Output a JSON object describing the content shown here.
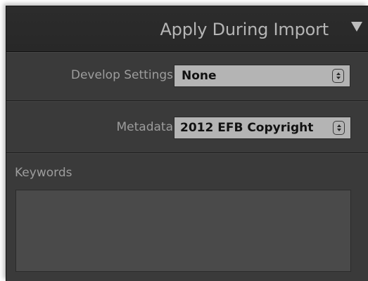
{
  "panel": {
    "title": "Apply During Import"
  },
  "develop_settings": {
    "label": "Develop Settings",
    "value": "None"
  },
  "metadata": {
    "label": "Metadata",
    "value": "2012 EFB Copyright"
  },
  "keywords": {
    "label": "Keywords",
    "value": ""
  },
  "icons": {
    "collapse": "triangle-down-icon",
    "stepper": "up-down-stepper-icon"
  },
  "colors": {
    "panel_bg": "#3a3a3a",
    "header_bg": "#2a2a2a",
    "select_bg": "#b4b4b4",
    "label_text": "#9d9d9d",
    "title_text": "#b5b5b5",
    "input_bg": "#4a4a4a"
  }
}
